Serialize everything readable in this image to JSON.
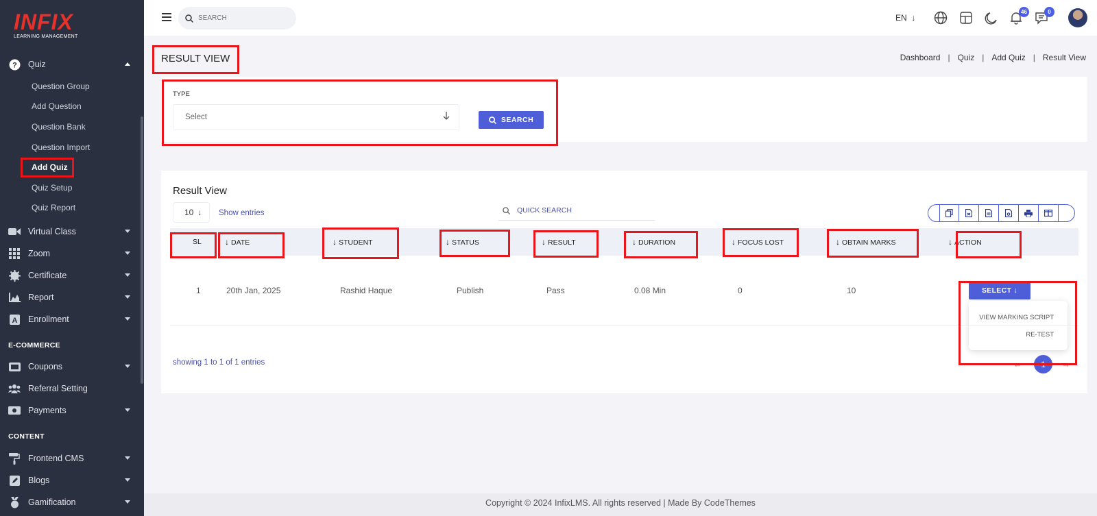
{
  "sidebar": {
    "logo_text": "INFIX",
    "logo_sub": "LEARNING MANAGEMENT",
    "quiz_label": "Quiz",
    "quiz_subitems": [
      "Question Group",
      "Add Question",
      "Question Bank",
      "Question Import",
      "Add Quiz",
      "Quiz Setup",
      "Quiz Report"
    ],
    "items": [
      "Virtual Class",
      "Zoom",
      "Certificate",
      "Report",
      "Enrollment"
    ],
    "ecommerce_label": "E-COMMERCE",
    "ecommerce_items": [
      "Coupons",
      "Referral Setting",
      "Payments"
    ],
    "content_label": "CONTENT",
    "content_items": [
      "Frontend CMS",
      "Blogs",
      "Gamification"
    ]
  },
  "topbar": {
    "search_placeholder": "SEARCH",
    "language": "EN",
    "notifications_count": "46",
    "messages_count": "0"
  },
  "page": {
    "title": "RESULT VIEW",
    "breadcrumb": [
      "Dashboard",
      "Quiz",
      "Add Quiz",
      "Result View"
    ]
  },
  "filter": {
    "type_label": "TYPE",
    "type_value": "Select",
    "search_button": "SEARCH"
  },
  "results": {
    "title": "Result View",
    "entries_value": "10",
    "entries_label": "Show entries",
    "quick_search_placeholder": "QUICK SEARCH",
    "columns": [
      "SL",
      "DATE",
      "STUDENT",
      "STATUS",
      "RESULT",
      "DURATION",
      "FOCUS LOST",
      "OBTAIN MARKS",
      "ACTION"
    ],
    "rows": [
      {
        "sl": "1",
        "date": "20th Jan, 2025",
        "student": "Rashid Haque",
        "status": "Publish",
        "result": "Pass",
        "duration": "0.08 Min",
        "focus_lost": "0",
        "obtain_marks": "10"
      }
    ],
    "action_button": "SELECT",
    "action_menu": [
      "VIEW MARKING SCRIPT",
      "RE-TEST"
    ],
    "showing_text": "showing 1 to 1 of 1 entries",
    "current_page": "1"
  },
  "footer": {
    "text": "Copyright © 2024 InfixLMS. All rights reserved | Made By CodeThemes"
  },
  "colors": {
    "accent": "#4d5ed8",
    "sidebar_bg": "#2b3040",
    "highlight_border": "#e8151b",
    "logo_red": "#e6322b"
  }
}
